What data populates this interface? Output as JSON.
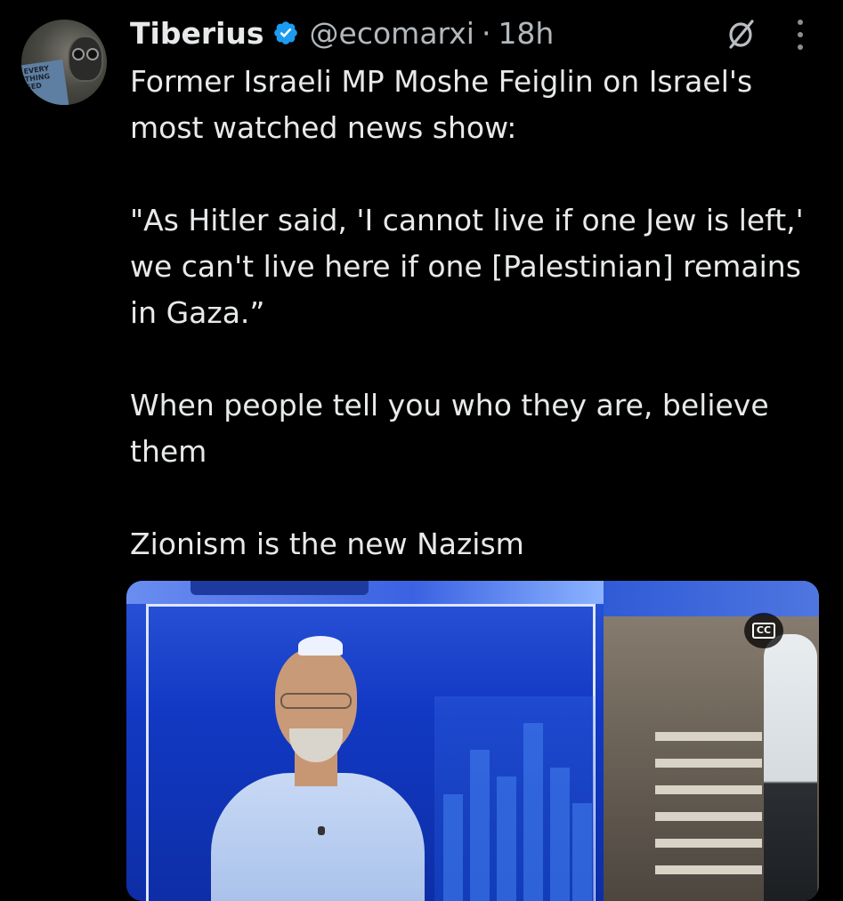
{
  "author": {
    "display_name": "Tiberius",
    "handle": "@ecomarxi",
    "separator": "·",
    "time": "18h",
    "verified": true,
    "avatar_book_text": "EVERY THING SED"
  },
  "tweet": {
    "paragraphs": [
      "Former Israeli MP Moshe Feiglin on Israel's most watched news show:",
      "\"As Hitler said, 'I cannot live if one Jew is left,' we can't live here if one [Palestinian] remains in Gaza.”",
      "When people tell you who they are, believe them",
      "Zionism is the new Nazism"
    ]
  },
  "media": {
    "type": "video",
    "cc_label": "CC"
  },
  "icons": {
    "verified": "verified-badge-icon",
    "grok": "grok-icon",
    "more": "more-options-icon",
    "captions": "closed-captions-icon"
  },
  "colors": {
    "background": "#000000",
    "text": "#e7e9ea",
    "secondary_text": "#b3b8bd",
    "verified_blue": "#1d9bf0"
  }
}
